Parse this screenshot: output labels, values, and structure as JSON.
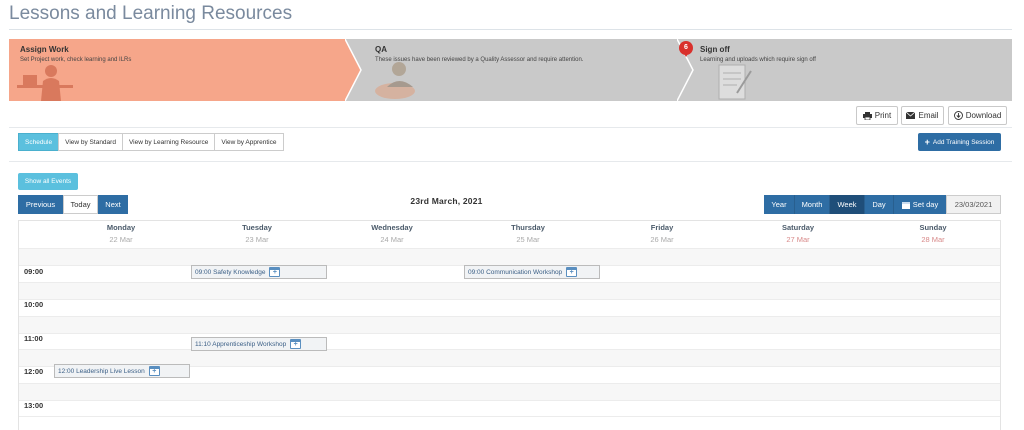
{
  "page": {
    "title": "Lessons and Learning Resources"
  },
  "workflow": {
    "steps": [
      {
        "title": "Assign Work",
        "description": "Set Project work, check learning and ILRs",
        "color": "#f6a68a"
      },
      {
        "title": "QA",
        "description": "These issues have been reviewed by a Quality Assessor and require attention.",
        "color": "#c9c9c9"
      },
      {
        "title": "Sign off",
        "description": "Learning and uploads which require sign off",
        "color": "#c9c9c9",
        "badge": "6"
      }
    ]
  },
  "actions": {
    "print": "Print",
    "email": "Email",
    "download": "Download"
  },
  "view_tabs": [
    "Schedule",
    "View by Standard",
    "View by Learning Resource",
    "View by Apprentice"
  ],
  "add_session_label": "Add Training Session",
  "show_all_label": "Show all Events",
  "nav": {
    "previous": "Previous",
    "today": "Today",
    "next": "Next"
  },
  "current_date": "23rd March, 2021",
  "view_modes": {
    "year": "Year",
    "month": "Month",
    "week": "Week",
    "day": "Day",
    "set_day": "Set day",
    "active": "Week"
  },
  "date_input": "23/03/2021",
  "calendar": {
    "days": [
      {
        "name": "Monday",
        "date": "22 Mar"
      },
      {
        "name": "Tuesday",
        "date": "23 Mar"
      },
      {
        "name": "Wednesday",
        "date": "24 Mar"
      },
      {
        "name": "Thursday",
        "date": "25 Mar"
      },
      {
        "name": "Friday",
        "date": "26 Mar"
      },
      {
        "name": "Saturday",
        "date": "27 Mar"
      },
      {
        "name": "Sunday",
        "date": "28 Mar"
      }
    ],
    "times": [
      "09:00",
      "10:00",
      "11:00",
      "12:00",
      "13:00"
    ],
    "events": [
      {
        "label": "09:00 Safety Knowledge"
      },
      {
        "label": "09:00 Communication Workshop"
      },
      {
        "label": "11:10 Apprenticeship Workshop"
      },
      {
        "label": "12:00 Leadership Live Lesson"
      }
    ]
  },
  "colors": {
    "primary": "#2e6da4",
    "info": "#5bc0de",
    "accent_step": "#f6a68a",
    "badge": "#d9302c"
  }
}
